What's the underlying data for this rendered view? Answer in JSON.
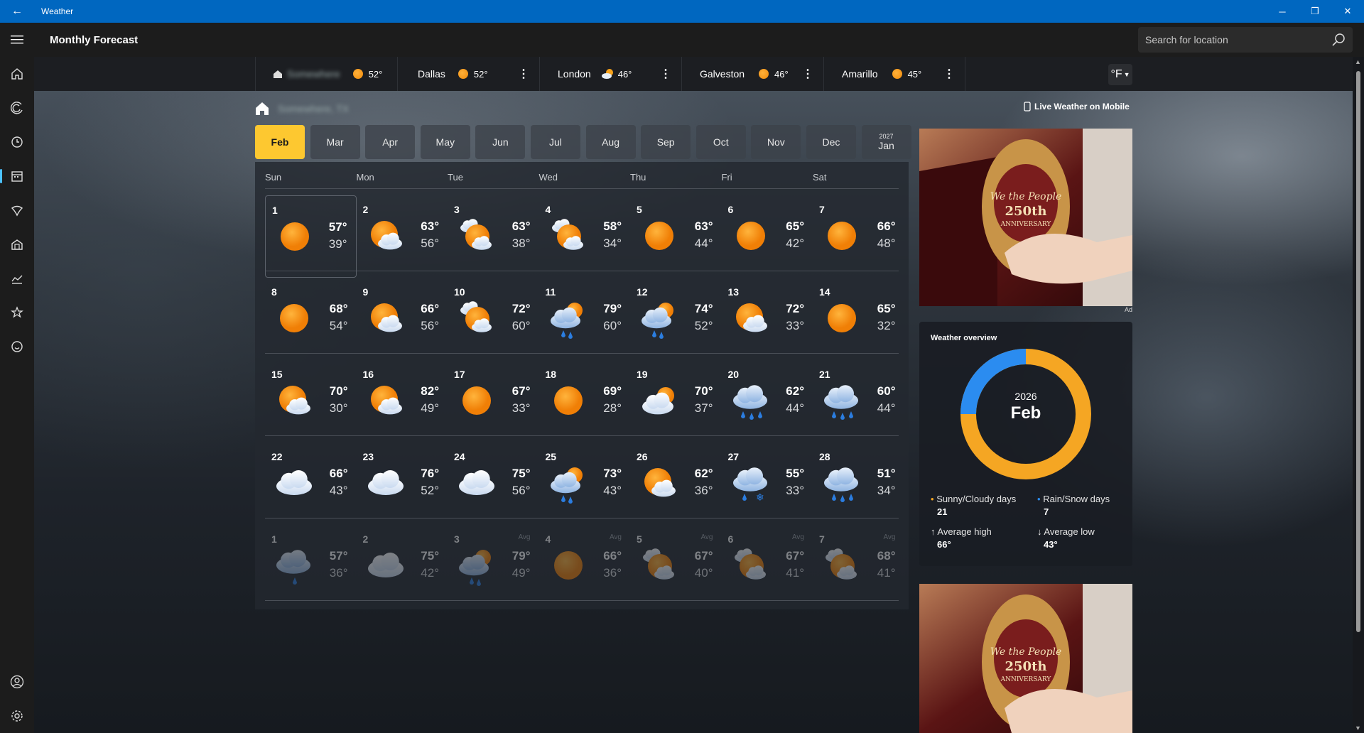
{
  "window": {
    "title": "Weather",
    "back": "←",
    "min": "─",
    "max": "❐",
    "close": "✕"
  },
  "header": {
    "page_title": "Monthly Forecast",
    "search_placeholder": "Search for location"
  },
  "sidebar": {
    "items": [
      "home-icon",
      "forecast-icon",
      "history-icon",
      "calendar-icon",
      "map-icon",
      "home-alt-icon",
      "trends-icon",
      "favorites-icon",
      "smile-icon"
    ],
    "active": "calendar-icon",
    "bottom": [
      "account-icon",
      "settings-icon"
    ]
  },
  "locations": [
    {
      "name": "",
      "temp": "52°",
      "icon": "sun",
      "home": true
    },
    {
      "name": "Dallas",
      "temp": "52°",
      "icon": "sun"
    },
    {
      "name": "London",
      "temp": "46°",
      "icon": "cloud-sun"
    },
    {
      "name": "Galveston",
      "temp": "46°",
      "icon": "sun"
    },
    {
      "name": "Amarillo",
      "temp": "45°",
      "icon": "sun"
    }
  ],
  "unit": "°F",
  "live_link": "Live Weather on Mobile",
  "months": [
    {
      "label": "Feb",
      "year": "",
      "selected": true
    },
    {
      "label": "Mar",
      "year": ""
    },
    {
      "label": "Apr",
      "year": ""
    },
    {
      "label": "May",
      "year": ""
    },
    {
      "label": "Jun",
      "year": ""
    },
    {
      "label": "Jul",
      "year": ""
    },
    {
      "label": "Aug",
      "year": ""
    },
    {
      "label": "Sep",
      "year": ""
    },
    {
      "label": "Oct",
      "year": ""
    },
    {
      "label": "Nov",
      "year": ""
    },
    {
      "label": "Dec",
      "year": ""
    },
    {
      "label": "Jan",
      "year": "2027"
    }
  ],
  "weekdays": [
    "Sun",
    "Mon",
    "Tue",
    "Wed",
    "Thu",
    "Fri",
    "Sat"
  ],
  "days": [
    {
      "d": "1",
      "hi": "57°",
      "lo": "39°",
      "icon": "sun",
      "today": true
    },
    {
      "d": "2",
      "hi": "63°",
      "lo": "56°",
      "icon": "sun-cloud"
    },
    {
      "d": "3",
      "hi": "63°",
      "lo": "38°",
      "icon": "cloud-sun-cloud"
    },
    {
      "d": "4",
      "hi": "58°",
      "lo": "34°",
      "icon": "cloud-sun-cloud"
    },
    {
      "d": "5",
      "hi": "63°",
      "lo": "44°",
      "icon": "sun"
    },
    {
      "d": "6",
      "hi": "65°",
      "lo": "42°",
      "icon": "sun"
    },
    {
      "d": "7",
      "hi": "66°",
      "lo": "48°",
      "icon": "sun"
    },
    {
      "d": "8",
      "hi": "68°",
      "lo": "54°",
      "icon": "sun"
    },
    {
      "d": "9",
      "hi": "66°",
      "lo": "56°",
      "icon": "sun-cloud"
    },
    {
      "d": "10",
      "hi": "72°",
      "lo": "60°",
      "icon": "cloud-sun-cloud"
    },
    {
      "d": "11",
      "hi": "79°",
      "lo": "60°",
      "icon": "sun-rain"
    },
    {
      "d": "12",
      "hi": "74°",
      "lo": "52°",
      "icon": "sun-rain"
    },
    {
      "d": "13",
      "hi": "72°",
      "lo": "33°",
      "icon": "sun-cloud"
    },
    {
      "d": "14",
      "hi": "65°",
      "lo": "32°",
      "icon": "sun"
    },
    {
      "d": "15",
      "hi": "70°",
      "lo": "30°",
      "icon": "sun-cloud"
    },
    {
      "d": "16",
      "hi": "82°",
      "lo": "49°",
      "icon": "sun-cloud"
    },
    {
      "d": "17",
      "hi": "67°",
      "lo": "33°",
      "icon": "sun"
    },
    {
      "d": "18",
      "hi": "69°",
      "lo": "28°",
      "icon": "sun"
    },
    {
      "d": "19",
      "hi": "70°",
      "lo": "37°",
      "icon": "cloud-sun"
    },
    {
      "d": "20",
      "hi": "62°",
      "lo": "44°",
      "icon": "rain"
    },
    {
      "d": "21",
      "hi": "60°",
      "lo": "44°",
      "icon": "rain"
    },
    {
      "d": "22",
      "hi": "66°",
      "lo": "43°",
      "icon": "cloud"
    },
    {
      "d": "23",
      "hi": "76°",
      "lo": "52°",
      "icon": "cloud"
    },
    {
      "d": "24",
      "hi": "75°",
      "lo": "56°",
      "icon": "cloud"
    },
    {
      "d": "25",
      "hi": "73°",
      "lo": "43°",
      "icon": "sun-rain"
    },
    {
      "d": "26",
      "hi": "62°",
      "lo": "36°",
      "icon": "sun-cloud"
    },
    {
      "d": "27",
      "hi": "55°",
      "lo": "33°",
      "icon": "snow"
    },
    {
      "d": "28",
      "hi": "51°",
      "lo": "34°",
      "icon": "rain"
    },
    {
      "d": "1",
      "hi": "57°",
      "lo": "36°",
      "icon": "cloud-rain",
      "future": true,
      "avg": ""
    },
    {
      "d": "2",
      "hi": "75°",
      "lo": "42°",
      "icon": "cloud",
      "future": true,
      "avg": ""
    },
    {
      "d": "3",
      "hi": "79°",
      "lo": "49°",
      "icon": "sun-rain",
      "future": true,
      "avg": "Avg"
    },
    {
      "d": "4",
      "hi": "66°",
      "lo": "36°",
      "icon": "sun",
      "future": true,
      "avg": "Avg"
    },
    {
      "d": "5",
      "hi": "67°",
      "lo": "40°",
      "icon": "cloud-sun-cloud",
      "future": true,
      "avg": "Avg"
    },
    {
      "d": "6",
      "hi": "67°",
      "lo": "41°",
      "icon": "cloud-sun-cloud",
      "future": true,
      "avg": "Avg"
    },
    {
      "d": "7",
      "hi": "68°",
      "lo": "41°",
      "icon": "cloud-sun-cloud",
      "future": true,
      "avg": "Avg"
    }
  ],
  "ad": {
    "label": "Ad",
    "text": "We the People",
    "sub": "250th",
    "sub2": "ANNIVERSARY"
  },
  "overview": {
    "title": "Weather overview",
    "year": "2026",
    "month": "Feb",
    "sunny_label": "Sunny/Cloudy days",
    "sunny": "21",
    "rain_label": "Rain/Snow days",
    "rain": "7",
    "high_label": "Average high",
    "high": "66°",
    "low_label": "Average low",
    "low": "43°",
    "colors": {
      "sunny": "#f39c12",
      "rain": "#2b8cf0"
    }
  }
}
